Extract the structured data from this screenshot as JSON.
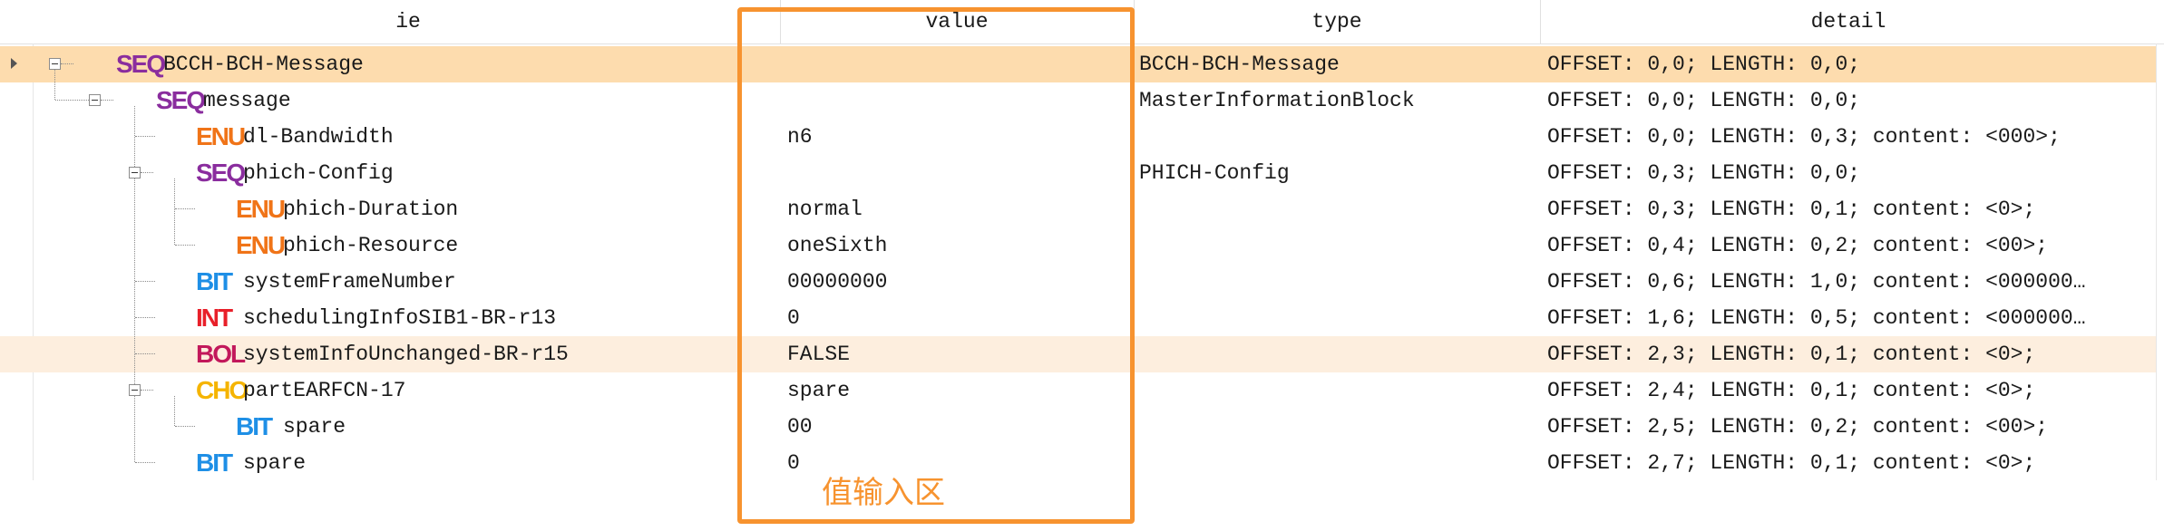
{
  "columns": {
    "ie": "ie",
    "value": "value",
    "type": "type",
    "detail": "detail"
  },
  "rows": [
    {
      "badge": "SEQ",
      "badge_kind": "seq",
      "name": "BCCH-BCH-Message",
      "value": "",
      "type": "BCCH-BCH-Message",
      "detail": "OFFSET: 0,0; LENGTH: 0,0;",
      "state": "selected"
    },
    {
      "badge": "SEQ",
      "badge_kind": "seq",
      "name": "message",
      "value": "",
      "type": "MasterInformationBlock",
      "detail": "OFFSET: 0,0; LENGTH: 0,0;",
      "state": ""
    },
    {
      "badge": "ENU",
      "badge_kind": "enu",
      "name": "dl-Bandwidth",
      "value": "n6",
      "type": "",
      "detail": "OFFSET: 0,0; LENGTH: 0,3; content: <000>;",
      "state": ""
    },
    {
      "badge": "SEQ",
      "badge_kind": "seq",
      "name": "phich-Config",
      "value": "",
      "type": "PHICH-Config",
      "detail": "OFFSET: 0,3; LENGTH: 0,0;",
      "state": ""
    },
    {
      "badge": "ENU",
      "badge_kind": "enu",
      "name": "phich-Duration",
      "value": "normal",
      "type": "",
      "detail": "OFFSET: 0,3; LENGTH: 0,1; content: <0>;",
      "state": ""
    },
    {
      "badge": "ENU",
      "badge_kind": "enu",
      "name": "phich-Resource",
      "value": "oneSixth",
      "type": "",
      "detail": "OFFSET: 0,4; LENGTH: 0,2; content: <00>;",
      "state": ""
    },
    {
      "badge": "BIT",
      "badge_kind": "bit",
      "name": "systemFrameNumber",
      "value": "00000000",
      "type": "",
      "detail": "OFFSET: 0,6; LENGTH: 1,0; content: <000000…",
      "state": ""
    },
    {
      "badge": "INT",
      "badge_kind": "int",
      "name": "schedulingInfoSIB1-BR-r13",
      "value": "0",
      "type": "",
      "detail": "OFFSET: 1,6; LENGTH: 0,5; content: <000000…",
      "state": ""
    },
    {
      "badge": "BOL",
      "badge_kind": "bol",
      "name": "systemInfoUnchanged-BR-r15",
      "value": "FALSE",
      "type": "",
      "detail": "OFFSET: 2,3; LENGTH: 0,1; content: <0>;",
      "state": "hover"
    },
    {
      "badge": "CHO",
      "badge_kind": "cho",
      "name": "partEARFCN-17",
      "value": "spare",
      "type": "",
      "detail": "OFFSET: 2,4; LENGTH: 0,1; content: <0>;",
      "state": ""
    },
    {
      "badge": "BIT",
      "badge_kind": "bit",
      "name": "spare",
      "value": "00",
      "type": "",
      "detail": "OFFSET: 2,5; LENGTH: 0,2; content: <00>;",
      "state": ""
    },
    {
      "badge": "BIT",
      "badge_kind": "bit",
      "name": "spare",
      "value": "0",
      "type": "",
      "detail": "OFFSET: 2,7; LENGTH: 0,1; content: <0>;",
      "state": ""
    }
  ],
  "annotation": {
    "label": "值输入区",
    "color": "#f7932f"
  },
  "colors": {
    "selected_row": "#fddcae",
    "hover_row": "#fdeede",
    "seq": "#8a2d9e",
    "enu": "#f07418",
    "bit": "#1e8fe6",
    "int": "#e8202a",
    "bol": "#c2185b",
    "cho": "#f5b400"
  }
}
